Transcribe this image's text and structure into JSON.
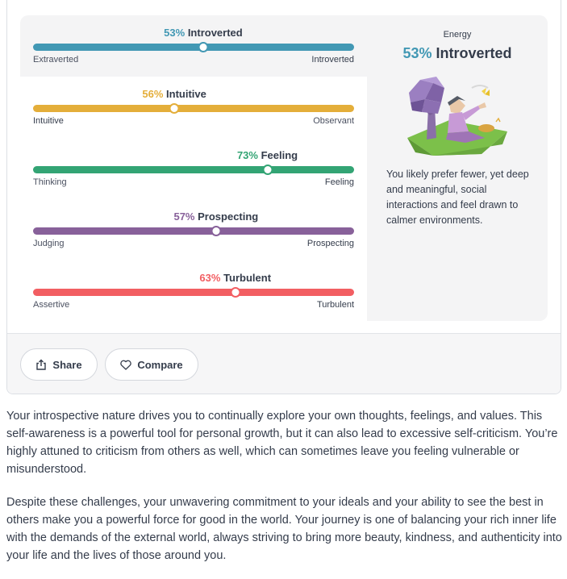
{
  "traits": [
    {
      "percent": "53%",
      "name": "Introverted",
      "left_label": "Extraverted",
      "right_label": "Introverted",
      "value": 53,
      "knob_position_pct": 53,
      "color": "#4298b4"
    },
    {
      "percent": "56%",
      "name": "Intuitive",
      "left_label": "Intuitive",
      "right_label": "Observant",
      "value": 56,
      "knob_position_pct": 44,
      "color": "#e4ae3a"
    },
    {
      "percent": "73%",
      "name": "Feeling",
      "left_label": "Thinking",
      "right_label": "Feeling",
      "value": 73,
      "knob_position_pct": 73,
      "color": "#33a474"
    },
    {
      "percent": "57%",
      "name": "Prospecting",
      "left_label": "Judging",
      "right_label": "Prospecting",
      "value": 57,
      "knob_position_pct": 57,
      "color": "#88619a"
    },
    {
      "percent": "63%",
      "name": "Turbulent",
      "left_label": "Assertive",
      "right_label": "Turbulent",
      "value": 63,
      "knob_position_pct": 63,
      "color": "#f25e62"
    }
  ],
  "sidebar": {
    "title": "Energy",
    "percent": "53%",
    "name": "Introverted",
    "description": "You likely prefer fewer, yet deep and meaningful, social interactions and feel drawn to calmer environments."
  },
  "actions": {
    "share_label": "Share",
    "compare_label": "Compare"
  },
  "paragraphs": [
    "Your introspective nature drives you to continually explore your own thoughts, feelings, and values. This self-awareness is a powerful tool for personal growth, but it can also lead to excessive self-criticism. You’re highly attuned to criticism from others as well, which can sometimes leave you feeling vulnerable or misunderstood.",
    "Despite these challenges, your unwavering commitment to your ideals and your ability to see the best in others make you a powerful force for good in the world. Your journey is one of balancing your rich inner life with the demands of the external world, always striving to bring more beauty, kindness, and authenticity into your life and the lives of those around you."
  ],
  "icons": {
    "share": "share-icon",
    "compare": "heart-icon",
    "illustration": "person-under-tree-illustration"
  }
}
